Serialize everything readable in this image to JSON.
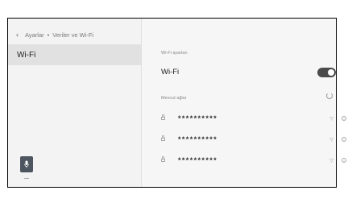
{
  "breadcrumb": {
    "items": [
      "Ayarlar",
      "Veriler ve Wi-Fi"
    ],
    "separator": "•"
  },
  "sidebar": {
    "items": [
      {
        "label": "Wi-Fi",
        "selected": true
      }
    ]
  },
  "main": {
    "wifi_settings_header": "Wi-Fi ayarları",
    "wifi_label": "Wi-Fi",
    "wifi_enabled": true,
    "available_networks_header": "Mevcut ağlar",
    "networks": [
      {
        "name": "**********",
        "locked": true,
        "signal_icon": "wifi-signal-icon"
      },
      {
        "name": "**********",
        "locked": true,
        "signal_icon": "wifi-signal-icon"
      },
      {
        "name": "**********",
        "locked": true,
        "signal_icon": "wifi-signal-icon"
      }
    ]
  },
  "colors": {
    "toggle_on": "#4a4a4a",
    "selected_item_bg": "#e1e1e1",
    "mic_button": "#4d5560"
  }
}
